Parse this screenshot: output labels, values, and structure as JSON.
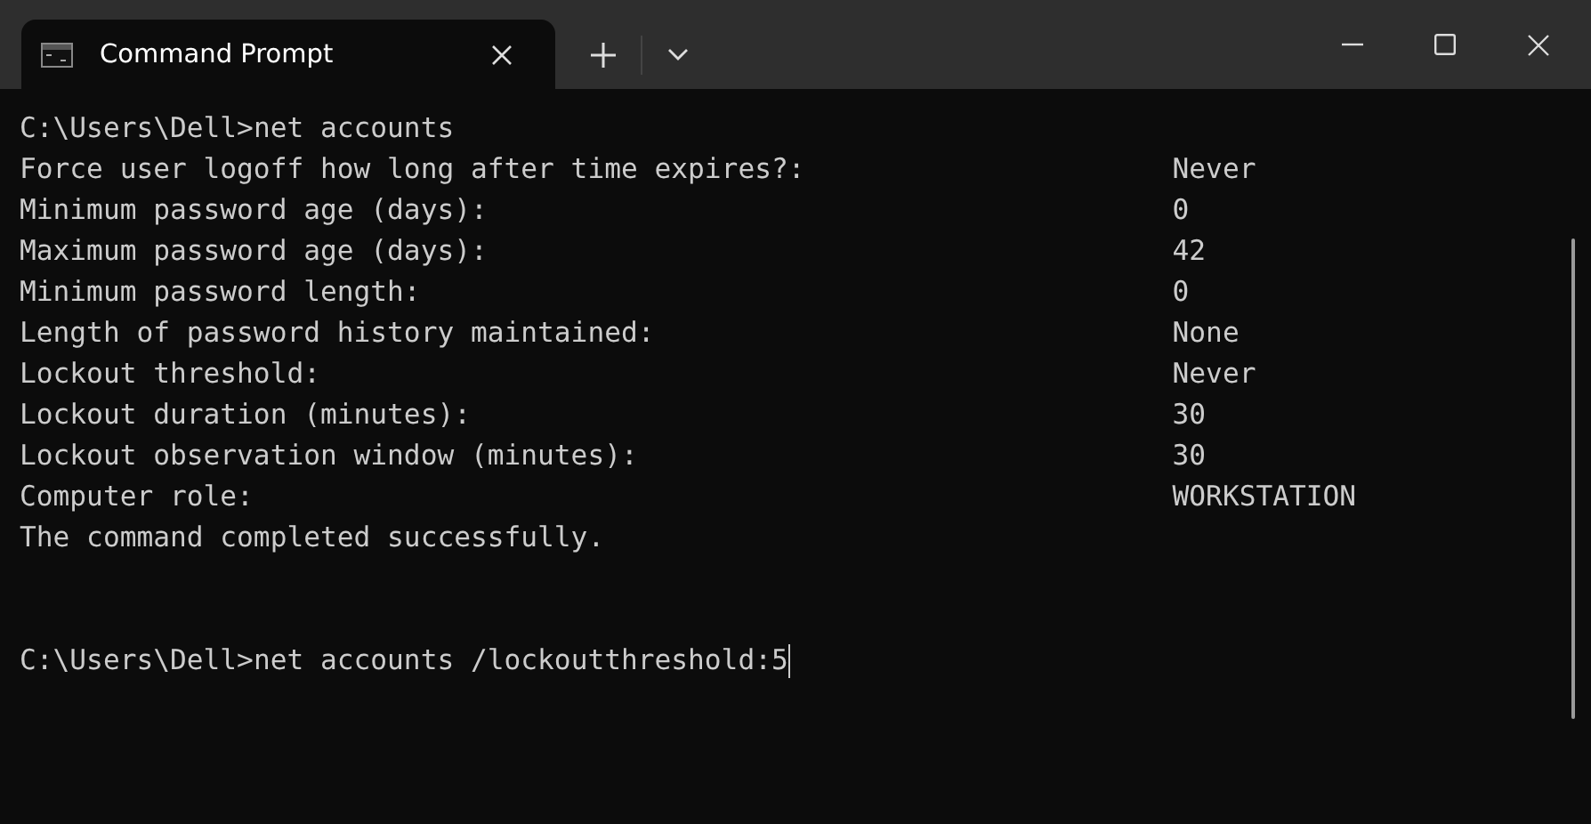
{
  "window": {
    "title": "Command Prompt"
  },
  "terminal": {
    "lines": [
      {
        "kind": "command",
        "prompt": "C:\\Users\\Dell>",
        "text": "net accounts"
      },
      {
        "kind": "field",
        "label": "Force user logoff how long after time expires?:",
        "value": "Never"
      },
      {
        "kind": "field",
        "label": "Minimum password age (days):",
        "value": "0"
      },
      {
        "kind": "field",
        "label": "Maximum password age (days):",
        "value": "42"
      },
      {
        "kind": "field",
        "label": "Minimum password length:",
        "value": "0"
      },
      {
        "kind": "field",
        "label": "Length of password history maintained:",
        "value": "None"
      },
      {
        "kind": "field",
        "label": "Lockout threshold:",
        "value": "Never"
      },
      {
        "kind": "field",
        "label": "Lockout duration (minutes):",
        "value": "30"
      },
      {
        "kind": "field",
        "label": "Lockout observation window (minutes):",
        "value": "30"
      },
      {
        "kind": "field",
        "label": "Computer role:",
        "value": "WORKSTATION"
      },
      {
        "kind": "message",
        "text": "The command completed successfully."
      },
      {
        "kind": "blank"
      },
      {
        "kind": "blank"
      },
      {
        "kind": "command",
        "prompt": "C:\\Users\\Dell>",
        "text": "net accounts /lockoutthreshold:5",
        "cursor": true
      }
    ]
  }
}
